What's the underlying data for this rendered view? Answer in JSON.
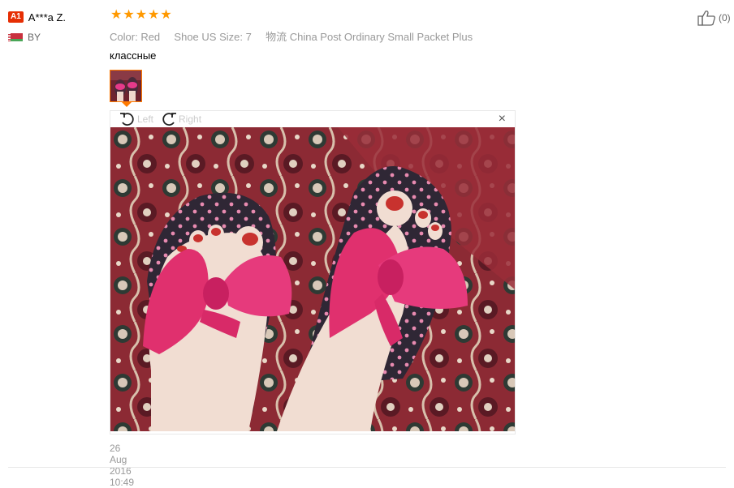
{
  "user": {
    "level_badge": "A1",
    "name": "A***a Z.",
    "country": "BY",
    "flag_icon": "belarus-flag-icon"
  },
  "review": {
    "rating": 5,
    "rating_max": 5,
    "color_label": "Color:",
    "color_value": "Red",
    "size_label": "Shoe US Size:",
    "size_value": "7",
    "shipping_label": "物流",
    "shipping_value": "China Post Ordinary Small Packet Plus",
    "text": "классные",
    "date": "26 Aug 2016 10:49"
  },
  "viewer": {
    "rotate_left_label": "Left",
    "rotate_right_label": "Right",
    "close_label": "×"
  },
  "like": {
    "count": "(0)",
    "icon": "thumbs-up-icon"
  },
  "colors": {
    "accent": "#ff9900",
    "badge": "#e62e04",
    "thumb_border": "#ff7a00",
    "flag_red": "#c8313e",
    "flag_green": "#4aa657"
  }
}
